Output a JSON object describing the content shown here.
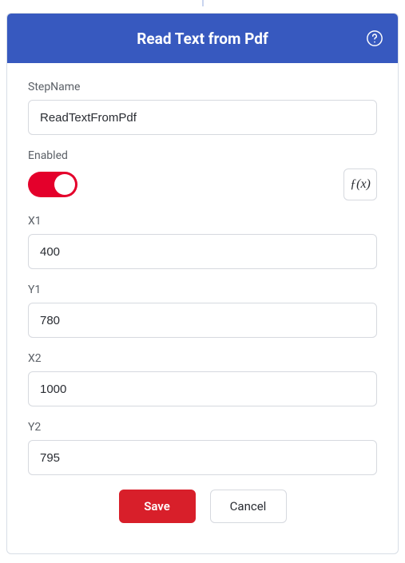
{
  "header": {
    "title": "Read Text from Pdf"
  },
  "fields": {
    "stepName": {
      "label": "StepName",
      "value": "ReadTextFromPdf"
    },
    "enabled": {
      "label": "Enabled",
      "on": true,
      "fx_label": "ƒ(x)"
    },
    "x1": {
      "label": "X1",
      "value": "400"
    },
    "y1": {
      "label": "Y1",
      "value": "780"
    },
    "x2": {
      "label": "X2",
      "value": "1000"
    },
    "y2": {
      "label": "Y2",
      "value": "795"
    }
  },
  "footer": {
    "save_label": "Save",
    "cancel_label": "Cancel"
  }
}
